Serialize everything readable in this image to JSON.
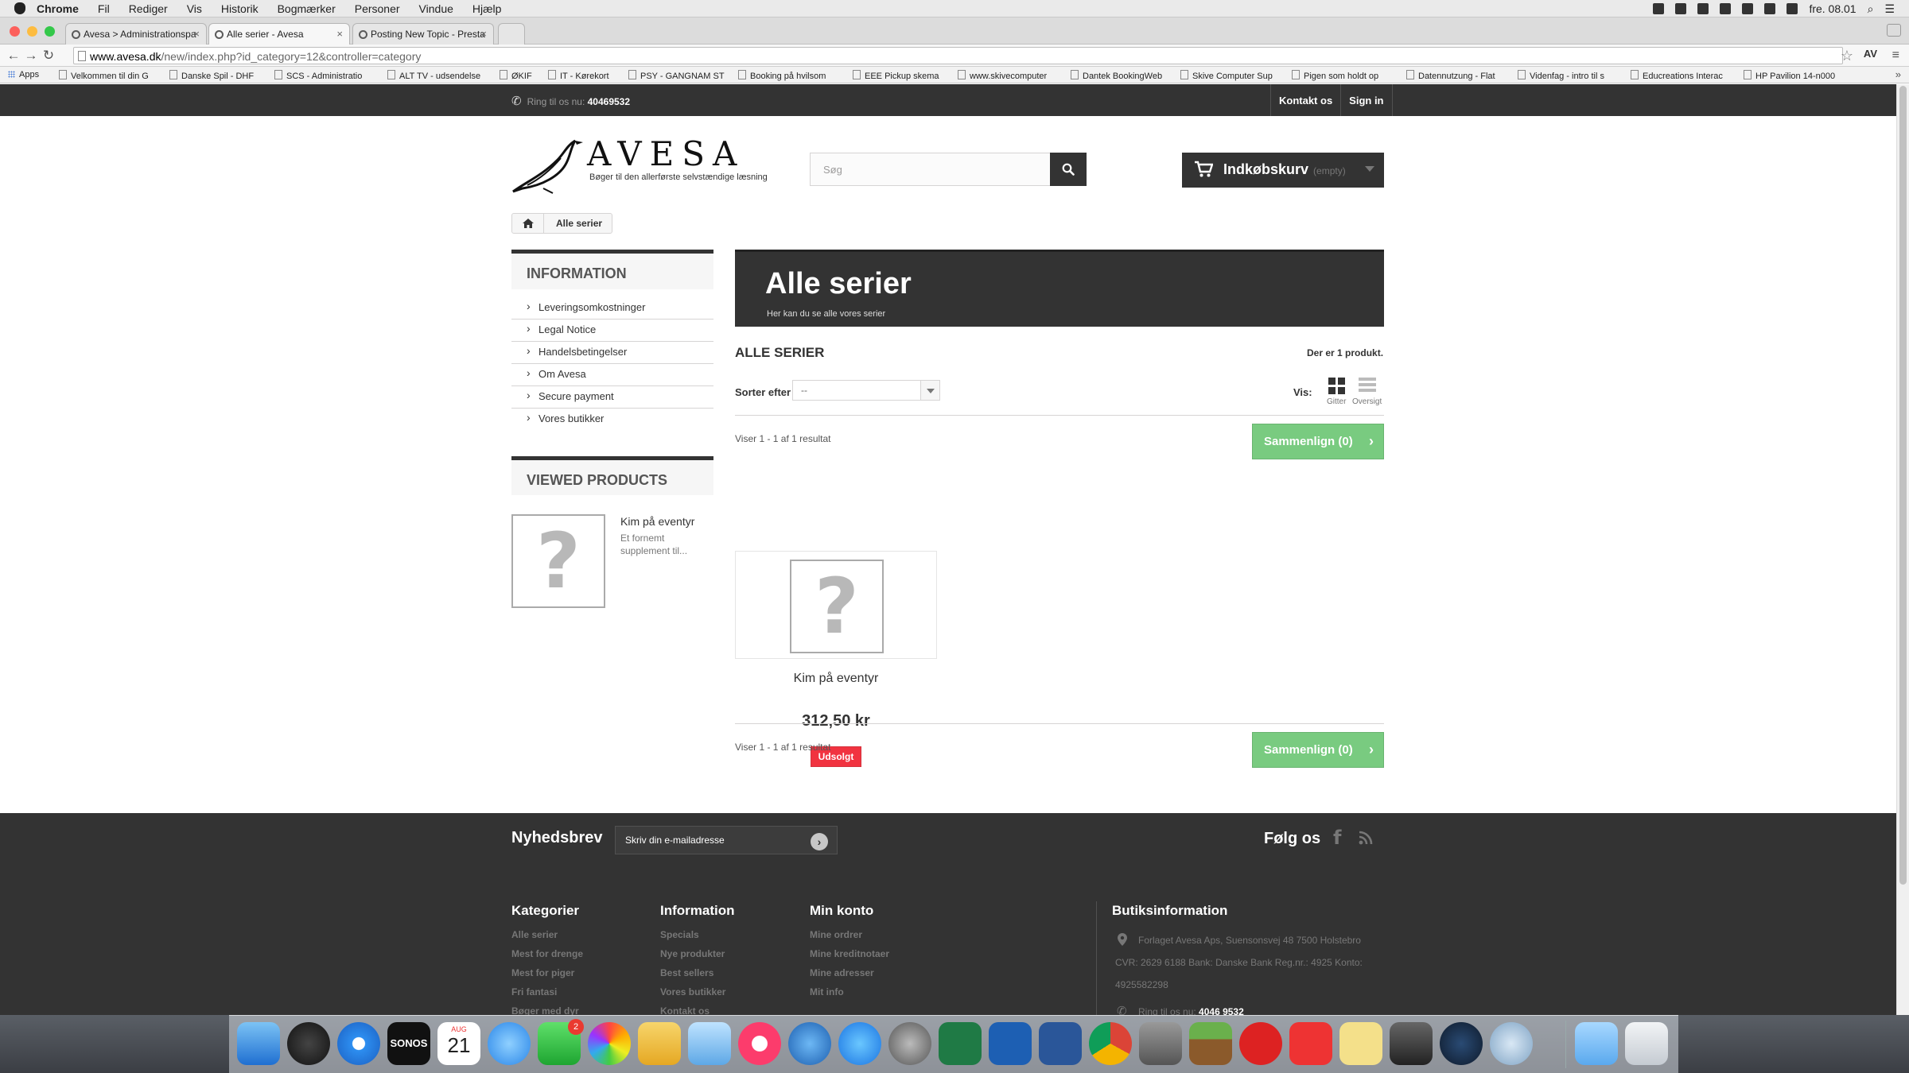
{
  "menubar": {
    "items": [
      "Chrome",
      "Fil",
      "Rediger",
      "Vis",
      "Historik",
      "Bogmærker",
      "Personer",
      "Vindue",
      "Hjælp"
    ],
    "clock": "fre. 08.01"
  },
  "browser": {
    "tabs": [
      {
        "title": "Avesa > Administrationspa"
      },
      {
        "title": "Alle serier - Avesa"
      },
      {
        "title": "Posting New Topic - Presta"
      }
    ],
    "url_host": "www.avesa.dk",
    "url_path": "/new/index.php?id_category=12&controller=category",
    "bookmarks": [
      "Apps",
      "Velkommen til din G",
      "Danske Spil - DHF",
      "SCS - Administratio",
      "ALT TV - udsendelse",
      "ØKIF",
      "IT - Kørekort",
      "PSY - GANGNAM ST",
      "Booking på hvilsom",
      "EEE Pickup skema",
      "www.skivecomputer",
      "Dantek BookingWeb",
      "Skive Computer Sup",
      "Pigen som holdt op",
      "Datennutzung - Flat",
      "Videnfag - intro til s",
      "Educreations Interac",
      "HP Pavilion 14-n000"
    ]
  },
  "topnav": {
    "phone_label": "Ring til os nu:",
    "phone_number": "40469532",
    "contact_label": "Kontakt os",
    "signin_label": "Sign in"
  },
  "header": {
    "logo_text": "AVESA",
    "logo_tagline": "Bøger til den allerførste selvstændige læsning",
    "search_placeholder": "Søg",
    "cart_label": "Indkøbskurv",
    "cart_status": "(empty)"
  },
  "breadcrumb": {
    "current": "Alle serier"
  },
  "sidebar": {
    "info_title": "Information",
    "info_links": [
      "Leveringsomkostninger",
      "Legal Notice",
      "Handelsbetingelser",
      "Om Avesa",
      "Secure payment",
      "Vores butikker"
    ],
    "viewed_title": "Viewed products",
    "viewed_product_name": "Kim på eventyr",
    "viewed_product_desc": "Et fornemt supplement til..."
  },
  "category": {
    "title": "Alle serier",
    "subtitle": "Her kan du se alle vores serier",
    "heading": "ALLE SERIER",
    "product_count": "Der er 1 produkt.",
    "sort_label": "Sorter efter",
    "sort_value": "--",
    "view_label": "Vis:",
    "view_grid": "Gitter",
    "view_list": "Oversigt",
    "showing": "Viser 1 - 1 af 1 resultat",
    "compare_label": "Sammenlign (0)"
  },
  "product": {
    "name": "Kim på eventyr",
    "price": "312,50 kr",
    "badge": "Udsolgt",
    "image_placeholder": "?"
  },
  "newsletter": {
    "title": "Nyhedsbrev",
    "placeholder": "Skriv din e-mailadresse",
    "follow_title": "Følg os"
  },
  "footer": {
    "categories_title": "Kategorier",
    "categories": [
      "Alle serier",
      "Mest for drenge",
      "Mest for piger",
      "Fri fantasi",
      "Bøger med dyr"
    ],
    "information_title": "Information",
    "information": [
      "Specials",
      "Nye produkter",
      "Best sellers",
      "Vores butikker",
      "Kontakt os"
    ],
    "account_title": "Min konto",
    "account": [
      "Mine ordrer",
      "Mine kreditnotaer",
      "Mine adresser",
      "Mit info"
    ],
    "store_title": "Butiksinformation",
    "store_address": "Forlaget Avesa Aps, Suensonsvej 48 7500 Holstebro",
    "store_cvr": "CVR: 2629 6188 Bank: Danske Bank Reg.nr.: 4925 Konto: 4925582298",
    "store_phone_label": "Ring til os nu:",
    "store_phone": "4046 9532"
  },
  "dock": {
    "badge_count": "2",
    "calendar_month": "AUG",
    "calendar_day": "21",
    "sonos_label": "SONOS"
  }
}
